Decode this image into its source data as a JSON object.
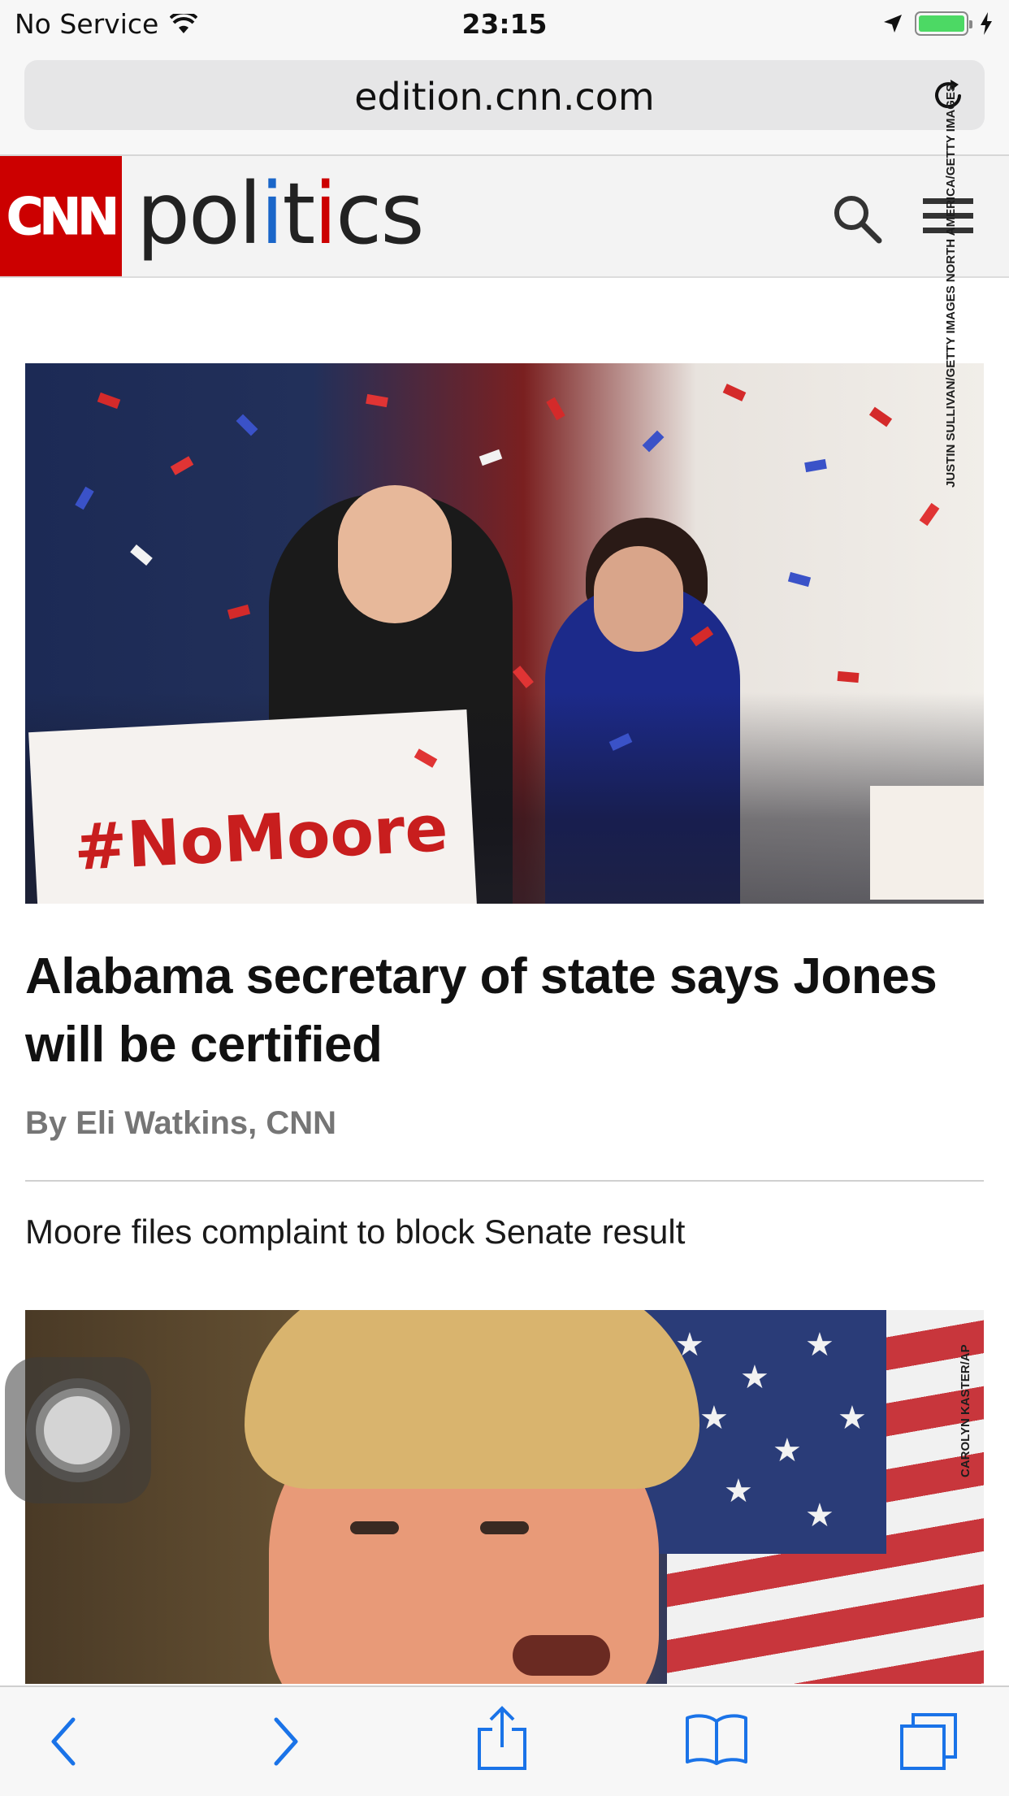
{
  "status_bar": {
    "carrier": "No Service",
    "time": "23:15",
    "battery_level": 1.0,
    "battery_color": "#4cd964"
  },
  "browser": {
    "url": "edition.cnn.com"
  },
  "site_header": {
    "logo_text": "CNN",
    "section": {
      "part1": "pol",
      "i1": "i",
      "part2": "t",
      "i2": "i",
      "part3": "cs"
    },
    "brand_color": "#cc0000"
  },
  "article": {
    "hero_image_credit": "JUSTIN SULLIVAN/GETTY IMAGES NORTH AMERICA/GETTY IMAGES",
    "hero_sign_text": "#NoMoore",
    "headline": "Alabama secretary of state says Jones will be certified",
    "byline": "By Eli Watkins, CNN",
    "related": "Moore files complaint to block Senate result",
    "second_image_credit": "CAROLYN KASTER/AP"
  },
  "toolbar": {
    "icons": [
      "back-icon",
      "forward-icon",
      "share-icon",
      "bookmarks-icon",
      "tabs-icon"
    ],
    "accent_color": "#1a73e8"
  }
}
